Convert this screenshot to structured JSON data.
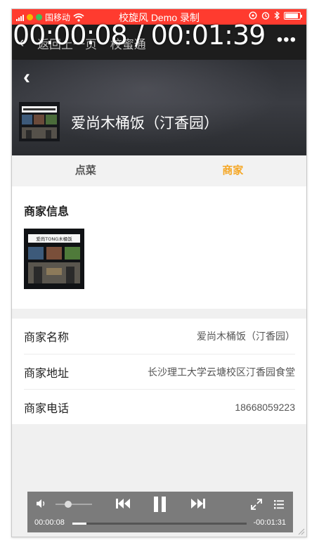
{
  "statusbar": {
    "carrier": "国移动",
    "title": "校旋风 Demo 录制",
    "battery_level": 0.9
  },
  "titlebar": {
    "back_text": "返回上一页",
    "title": "校蜜通",
    "more_icon": "ellipsis-icon"
  },
  "recording_overlay": {
    "time": "00:00:08 / 00:01:39"
  },
  "store": {
    "name": "爱尚木桶饭（汀香园）",
    "sign_text": "爱尚TONG木桶饭"
  },
  "tabs": [
    {
      "label": "点菜",
      "active": false
    },
    {
      "label": "商家",
      "active": true
    }
  ],
  "merchant_info": {
    "title": "商家信息"
  },
  "details": [
    {
      "label": "商家名称",
      "value": "爱尚木桶饭（汀香园）"
    },
    {
      "label": "商家地址",
      "value": "长沙理工大学云塘校区汀香园食堂"
    },
    {
      "label": "商家电话",
      "value": "18668059223"
    }
  ],
  "player": {
    "elapsed": "00:00:08",
    "remaining": "-00:01:31",
    "progress": 0.08,
    "volume": 0.35
  },
  "colors": {
    "statusbar": "#ff3b2f",
    "accent": "#f5a623",
    "player_bg": "#7b7b7b"
  }
}
